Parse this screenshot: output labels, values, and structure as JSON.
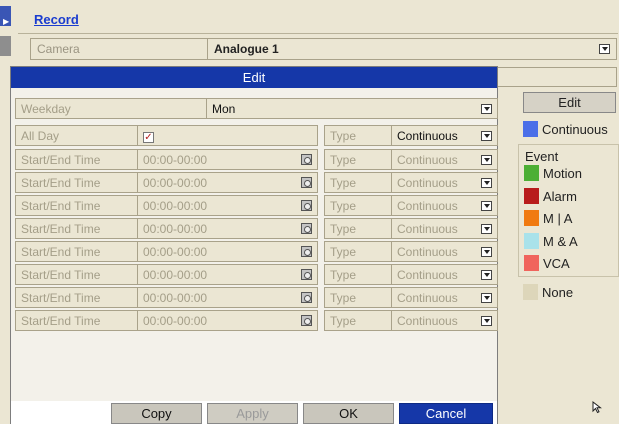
{
  "header": {
    "record_link": "Record"
  },
  "camera": {
    "label": "Camera",
    "value": "Analogue 1"
  },
  "dialog": {
    "title": "Edit",
    "weekday": {
      "label": "Weekday",
      "value": "Mon"
    },
    "all_day": {
      "label": "All Day",
      "checked": true,
      "type_label": "Type",
      "type_value": "Continuous"
    },
    "slots": [
      {
        "label": "Start/End Time",
        "time": "00:00-00:00",
        "type_label": "Type",
        "type_value": "Continuous"
      },
      {
        "label": "Start/End Time",
        "time": "00:00-00:00",
        "type_label": "Type",
        "type_value": "Continuous"
      },
      {
        "label": "Start/End Time",
        "time": "00:00-00:00",
        "type_label": "Type",
        "type_value": "Continuous"
      },
      {
        "label": "Start/End Time",
        "time": "00:00-00:00",
        "type_label": "Type",
        "type_value": "Continuous"
      },
      {
        "label": "Start/End Time",
        "time": "00:00-00:00",
        "type_label": "Type",
        "type_value": "Continuous"
      },
      {
        "label": "Start/End Time",
        "time": "00:00-00:00",
        "type_label": "Type",
        "type_value": "Continuous"
      },
      {
        "label": "Start/End Time",
        "time": "00:00-00:00",
        "type_label": "Type",
        "type_value": "Continuous"
      },
      {
        "label": "Start/End Time",
        "time": "00:00-00:00",
        "type_label": "Type",
        "type_value": "Continuous"
      }
    ],
    "buttons": {
      "copy": "Copy",
      "apply": "Apply",
      "ok": "OK",
      "cancel": "Cancel"
    }
  },
  "legend": {
    "edit_button": "Edit",
    "continuous": {
      "label": "Continuous",
      "color": "#4b6fe8"
    },
    "event_title": "Event",
    "events": [
      {
        "label": "Motion",
        "color": "#4caf35"
      },
      {
        "label": "Alarm",
        "color": "#b81c1c"
      },
      {
        "label": "M | A",
        "color": "#f07a10"
      },
      {
        "label": "M & A",
        "color": "#a9e2ea"
      },
      {
        "label": "VCA",
        "color": "#f0645c"
      }
    ],
    "none": {
      "label": "None",
      "color": "#ddd6ba"
    }
  }
}
